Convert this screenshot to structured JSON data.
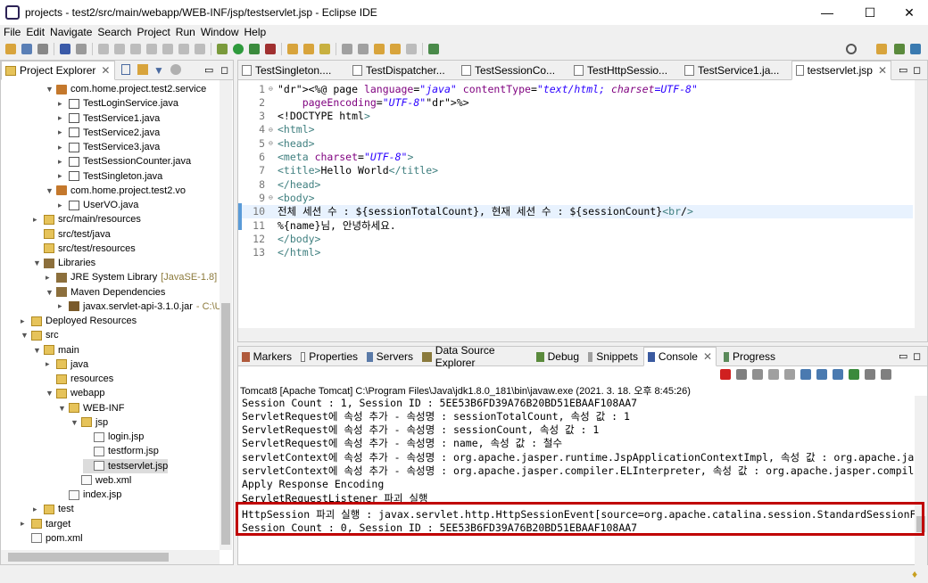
{
  "window": {
    "title": "projects - test2/src/main/webapp/WEB-INF/jsp/testservlet.jsp - Eclipse IDE",
    "min": "—",
    "max": "☐",
    "close": "✕"
  },
  "menu": [
    "File",
    "Edit",
    "Navigate",
    "Search",
    "Project",
    "Run",
    "Window",
    "Help"
  ],
  "explorer": {
    "title": "Project Explorer",
    "tree": [
      {
        "label": "com.home.project.test2.service",
        "icon": "package-icon"
      },
      {
        "label": "TestLoginService.java",
        "icon": "java-file-icon"
      },
      {
        "label": "TestService1.java",
        "icon": "java-file-icon"
      },
      {
        "label": "TestService2.java",
        "icon": "java-file-icon"
      },
      {
        "label": "TestService3.java",
        "icon": "java-file-icon"
      },
      {
        "label": "TestSessionCounter.java",
        "icon": "java-file-icon"
      },
      {
        "label": "TestSingleton.java",
        "icon": "java-file-icon"
      },
      {
        "label": "com.home.project.test2.vo",
        "icon": "package-icon"
      },
      {
        "label": "UserVO.java",
        "icon": "java-file-icon"
      },
      {
        "label": "src/main/resources",
        "icon": "source-folder-icon"
      },
      {
        "label": "src/test/java",
        "icon": "source-folder-icon"
      },
      {
        "label": "src/test/resources",
        "icon": "source-folder-icon"
      },
      {
        "label": "Libraries",
        "icon": "library-icon"
      },
      {
        "label": "JRE System Library",
        "suffix": "[JavaSE-1.8]",
        "icon": "library-icon"
      },
      {
        "label": "Maven Dependencies",
        "icon": "library-icon"
      },
      {
        "label": "javax.servlet-api-3.1.0.jar",
        "suffix": "- C:\\U:",
        "icon": "jar-icon"
      },
      {
        "label": "Deployed Resources",
        "icon": "folder-icon"
      },
      {
        "label": "src",
        "icon": "folder-icon"
      },
      {
        "label": "main",
        "icon": "folder-icon"
      },
      {
        "label": "java",
        "icon": "folder-icon"
      },
      {
        "label": "resources",
        "icon": "folder-icon"
      },
      {
        "label": "webapp",
        "icon": "folder-icon"
      },
      {
        "label": "WEB-INF",
        "icon": "folder-icon"
      },
      {
        "label": "jsp",
        "icon": "folder-icon"
      },
      {
        "label": "login.jsp",
        "icon": "file-icon"
      },
      {
        "label": "testform.jsp",
        "icon": "file-icon"
      },
      {
        "label": "testservlet.jsp",
        "icon": "file-icon"
      },
      {
        "label": "web.xml",
        "icon": "xml-file-icon"
      },
      {
        "label": "index.jsp",
        "icon": "file-icon"
      },
      {
        "label": "test",
        "icon": "folder-icon"
      },
      {
        "label": "target",
        "icon": "folder-icon"
      },
      {
        "label": "pom.xml",
        "icon": "xml-file-icon"
      }
    ]
  },
  "editor": {
    "tabs": [
      "TestSingleton....",
      "TestDispatcher...",
      "TestSessionCo...",
      "TestHttpSessio...",
      "TestService1.ja...",
      "testservlet.jsp"
    ],
    "lines": [
      {
        "n": "1",
        "text": "<%@ page language=\"java\" contentType=\"text/html; charset=UTF-8\""
      },
      {
        "n": "2",
        "text": "    pageEncoding=\"UTF-8\"%>"
      },
      {
        "n": "3",
        "text": "<!DOCTYPE html>"
      },
      {
        "n": "4",
        "text": "<html>"
      },
      {
        "n": "5",
        "text": "<head>"
      },
      {
        "n": "6",
        "text": "<meta charset=\"UTF-8\">"
      },
      {
        "n": "7",
        "text": "<title>Hello World</title>"
      },
      {
        "n": "8",
        "text": "</head>"
      },
      {
        "n": "9",
        "text": "<body>"
      },
      {
        "n": "10",
        "text": "전체 세션 수 : ${sessionTotalCount}, 현재 세션 수 : ${sessionCount}<br/>"
      },
      {
        "n": "11",
        "text": "%{name}님, 안녕하세요."
      },
      {
        "n": "12",
        "text": "</body>"
      },
      {
        "n": "13",
        "text": "</html>"
      }
    ]
  },
  "bottom": {
    "tabs": [
      "Markers",
      "Properties",
      "Servers",
      "Data Source Explorer",
      "Debug",
      "Snippets",
      "Console",
      "Progress"
    ],
    "console_header": "Tomcat8 [Apache Tomcat] C:\\Program Files\\Java\\jdk1.8.0_181\\bin\\javaw.exe  (2021. 3. 18. 오후 8:45:26)",
    "lines": [
      "Session Count : 1, Session ID : 5EE53B6FD39A76B20BD51EBAAF108AA7",
      "ServletRequest에 속성 추가 - 속성명 : sessionTotalCount, 속성 값 : 1",
      "ServletRequest에 속성 추가 - 속성명 : sessionCount, 속성 값 : 1",
      "ServletRequest에 속성 추가 - 속성명 : name, 속성 값 : 철수",
      "servletContext에 속성 추가 - 속성명 : org.apache.jasper.runtime.JspApplicationContextImpl, 속성 값 : org.apache.jasper",
      "servletContext에 속성 추가 - 속성명 : org.apache.jasper.compiler.ELInterpreter, 속성 값 : org.apache.jasper.compiler.E",
      "Apply Response Encoding",
      "ServletRequestListener 파괴 실행",
      "HttpSession 파괴 실행 : javax.servlet.http.HttpSessionEvent[source=org.apache.catalina.session.StandardSessionFaca",
      "Session Count : 0, Session ID : 5EE53B6FD39A76B20BD51EBAAF108AA7"
    ]
  },
  "colors": {
    "highlight_border": "#c00000",
    "accent": "#3f7f7f"
  }
}
